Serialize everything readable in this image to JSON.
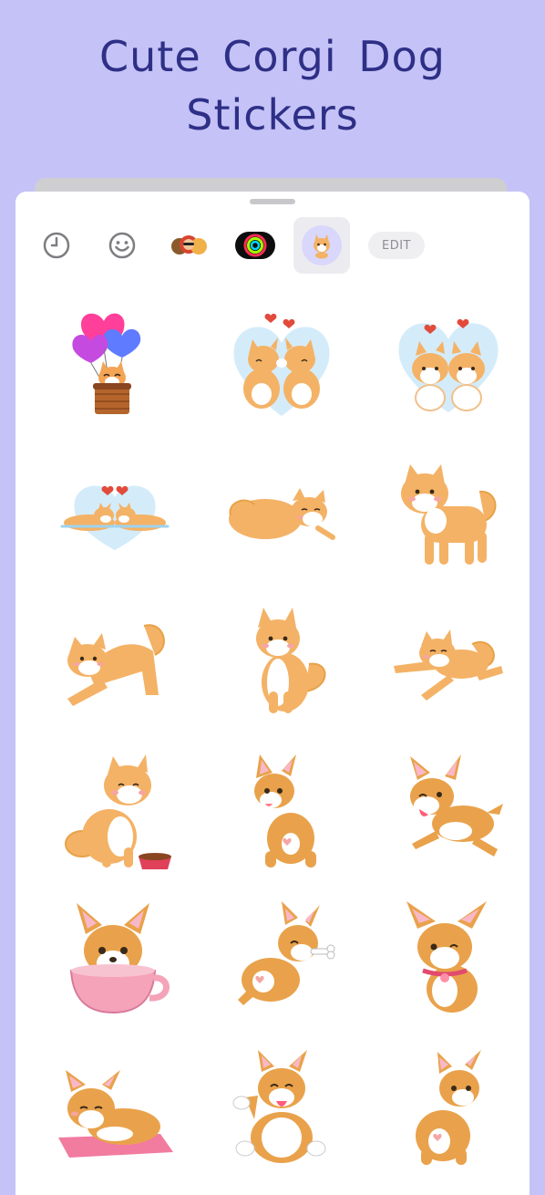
{
  "headline": {
    "line1": "Cute Corgi Dog",
    "line2": "Stickers"
  },
  "toolbar": {
    "recents_icon": "clock-icon",
    "emoji_icon": "smiley-icon",
    "memoji_icon": "memoji-pack-icon",
    "activity_icon": "activity-rings-icon",
    "selected_pack_icon": "corgi-pack-icon",
    "edit_label": "EDIT"
  },
  "stickers": [
    "corgi in heart balloon basket",
    "two corgis kissing in heart",
    "two corgis smiling in heart",
    "two corgis lying in heart",
    "sleeping shiba curled",
    "standing shiba",
    "stretching shiba",
    "sitting shiba",
    "sliding shiba",
    "shiba with food bowl",
    "corgi from behind",
    "running corgi",
    "corgi in teacup",
    "corgi with bone",
    "winking corgi with collar",
    "corgi lying on cushion",
    "corgi rolling on back",
    "corgi looking back"
  ],
  "colors": {
    "background": "#c5c2f7",
    "headline": "#2e2f86",
    "sheet": "#ffffff",
    "corgi_fur": "#f4b266",
    "corgi_fur_dark": "#e7a247"
  }
}
